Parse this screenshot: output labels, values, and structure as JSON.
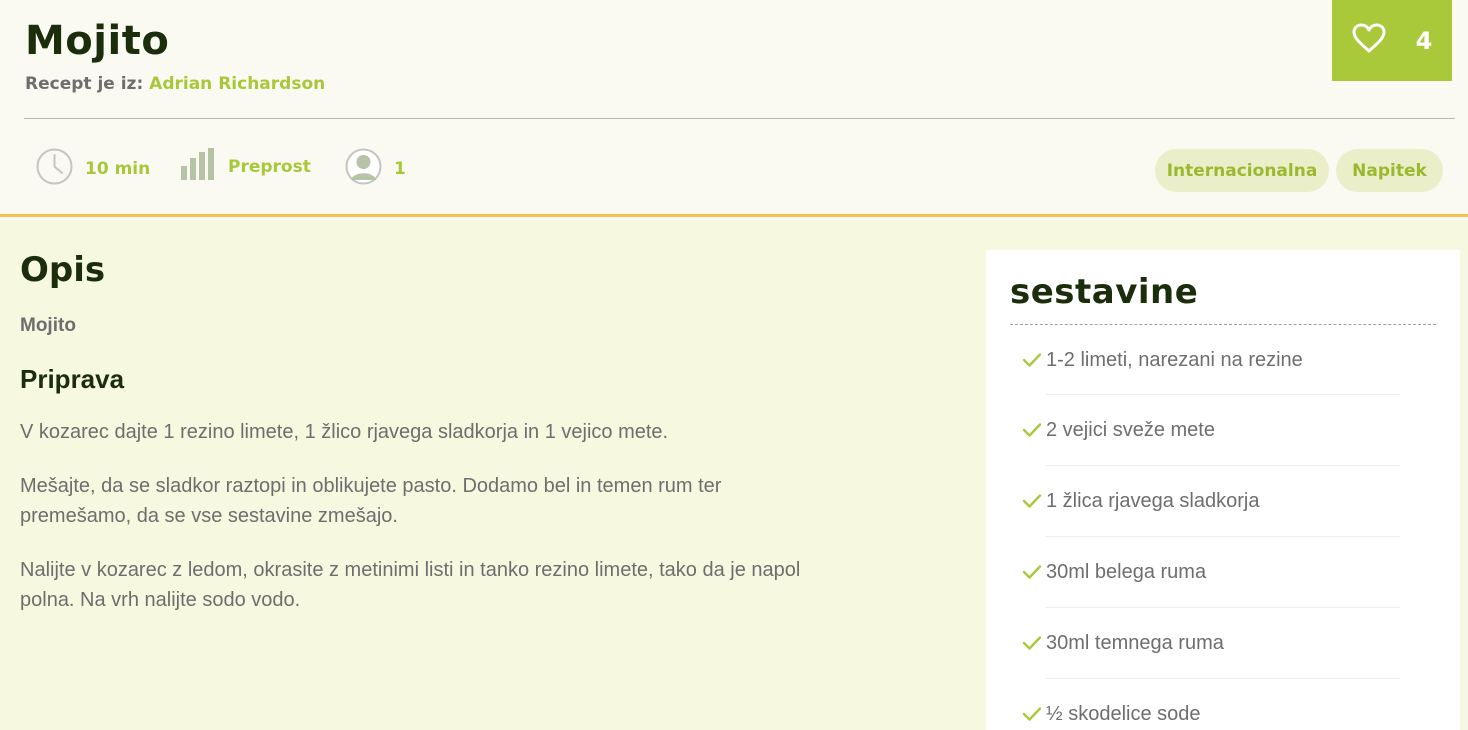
{
  "recipe": {
    "title": "Mojito",
    "source_label": "Recept je iz:",
    "author": "Adrian Richardson"
  },
  "likes": {
    "count": "4",
    "icon": "heart-icon"
  },
  "meta": {
    "time": "10 min",
    "difficulty": "Preprost",
    "servings": "1"
  },
  "tags": [
    "Internacionalna",
    "Napitek"
  ],
  "description": {
    "heading": "Opis",
    "text": "Mojito"
  },
  "preparation": {
    "heading": "Priprava",
    "steps": [
      "V kozarec dajte 1 rezino limete, 1 žlico rjavega sladkorja in 1 vejico mete.",
      "Mešajte, da se sladkor raztopi in oblikujete pasto. Dodamo bel in temen rum ter premešamo, da se vse sestavine zmešajo.",
      "Nalijte v kozarec z ledom, okrasite z metinimi listi in tanko rezino limete, tako da je napol polna. Na vrh nalijte sodo vodo."
    ]
  },
  "ingredients": {
    "heading": "sestavine",
    "items": [
      "1-2 limeti, narezani na rezine",
      "2 vejici sveže mete",
      "1 žlica rjavega sladkorja",
      "30ml belega ruma",
      "30ml temnega ruma",
      "½ skodelice sode"
    ]
  },
  "colors": {
    "accent_green": "#a9c93b",
    "header_border": "#f0c44c",
    "content_bg": "#f7f8e0",
    "dark_text": "#1b2d0b",
    "body_text": "#6e6e6e"
  }
}
